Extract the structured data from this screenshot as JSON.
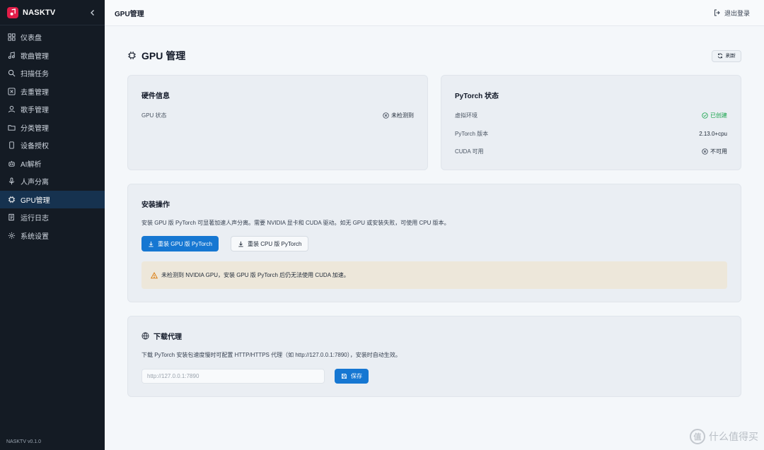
{
  "app": {
    "name": "NASKTV",
    "version": "NASKTV v0.1.0"
  },
  "sidebar": {
    "items": [
      {
        "label": "仪表盘",
        "icon": "dashboard-icon"
      },
      {
        "label": "歌曲管理",
        "icon": "music-icon"
      },
      {
        "label": "扫描任务",
        "icon": "search-icon"
      },
      {
        "label": "去重管理",
        "icon": "dedupe-icon"
      },
      {
        "label": "歌手管理",
        "icon": "user-icon"
      },
      {
        "label": "分类管理",
        "icon": "folder-icon"
      },
      {
        "label": "设备授权",
        "icon": "device-icon"
      },
      {
        "label": "AI解析",
        "icon": "robot-icon"
      },
      {
        "label": "人声分离",
        "icon": "mic-icon"
      },
      {
        "label": "GPU管理",
        "icon": "chip-icon",
        "active": true
      },
      {
        "label": "运行日志",
        "icon": "log-icon"
      },
      {
        "label": "系统设置",
        "icon": "gear-icon"
      }
    ]
  },
  "topbar": {
    "title": "GPU管理",
    "logout": "退出登录"
  },
  "page": {
    "title": "GPU 管理",
    "refresh": "刷新"
  },
  "hardware": {
    "title": "硬件信息",
    "rows": [
      {
        "label": "GPU 状态",
        "value": "未检测到"
      }
    ]
  },
  "pytorch": {
    "title": "PyTorch 状态",
    "rows": [
      {
        "label": "虚拟环境",
        "value": "已创建",
        "status": "ok"
      },
      {
        "label": "PyTorch 版本",
        "value": "2.13.0+cpu"
      },
      {
        "label": "CUDA 可用",
        "value": "不可用",
        "status": "no"
      }
    ]
  },
  "install": {
    "title": "安装操作",
    "desc": "安装 GPU 版 PyTorch 可显著加速人声分离。需要 NVIDIA 显卡和 CUDA 驱动。如无 GPU 或安装失败，可使用 CPU 版本。",
    "gpu_button": "重装 GPU 版 PyTorch",
    "cpu_button": "重装 CPU 版 PyTorch",
    "warning": "未检测到 NVIDIA GPU，安装 GPU 版 PyTorch 后仍无法使用 CUDA 加速。"
  },
  "proxy": {
    "title": "下载代理",
    "desc": "下载 PyTorch 安装包速度慢时可配置 HTTP/HTTPS 代理（如 http://127.0.0.1:7890），安装时自动生效。",
    "placeholder": "http://127.0.0.1:7890",
    "save": "保存"
  },
  "colors": {
    "primary": "#1677d2",
    "sidebar": "#141b24",
    "active": "#16324f",
    "success": "#16a34a",
    "warning": "#d97706"
  },
  "watermark": {
    "symbol": "值",
    "text": "什么值得买"
  }
}
